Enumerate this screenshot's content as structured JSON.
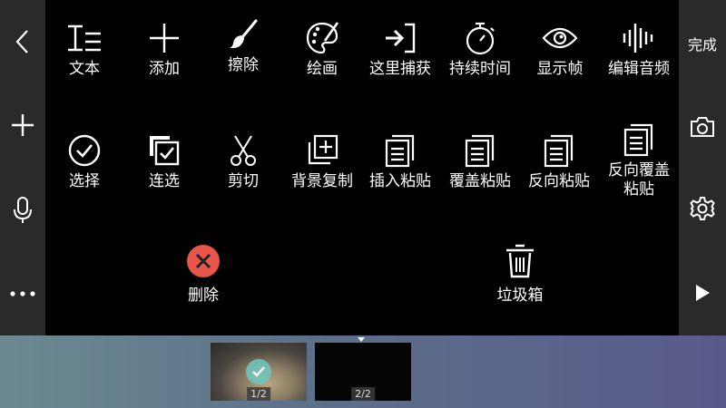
{
  "header": {
    "done_label": "完成"
  },
  "left_rail": {
    "items": [
      "back-icon",
      "add-icon",
      "microphone-icon",
      "more-icon"
    ]
  },
  "right_rail": {
    "items": [
      "camera-icon",
      "settings-icon",
      "play-icon"
    ]
  },
  "tools": [
    {
      "label": "文本",
      "icon": "text-icon"
    },
    {
      "label": "添加",
      "icon": "add-icon"
    },
    {
      "label": "擦除",
      "icon": "brush-icon"
    },
    {
      "label": "绘画",
      "icon": "palette-icon"
    },
    {
      "label": "这里捕获",
      "icon": "capture-icon"
    },
    {
      "label": "持续时间",
      "icon": "stopwatch-icon"
    },
    {
      "label": "显示帧",
      "icon": "eye-icon"
    },
    {
      "label": "编辑音频",
      "icon": "audio-wave-icon"
    },
    {
      "label": "选择",
      "icon": "check-circle-icon"
    },
    {
      "label": "连选",
      "icon": "multi-select-icon"
    },
    {
      "label": "剪切",
      "icon": "scissors-icon"
    },
    {
      "label": "背景复制",
      "icon": "copy-add-icon"
    },
    {
      "label": "插入粘贴",
      "icon": "paste-icon"
    },
    {
      "label": "覆盖粘贴",
      "icon": "paste-icon"
    },
    {
      "label": "反向粘贴",
      "icon": "paste-icon"
    },
    {
      "label": "反向覆盖粘贴",
      "icon": "paste-icon"
    }
  ],
  "actions": {
    "delete_label": "删除",
    "trash_label": "垃圾箱"
  },
  "frames": [
    {
      "page": "1/2",
      "selected": true
    },
    {
      "page": "2/2",
      "selected": false
    }
  ],
  "colors": {
    "delete_red": "#e8554a",
    "rail": "#2a2a2a",
    "accent_check": "#6ec8be"
  }
}
